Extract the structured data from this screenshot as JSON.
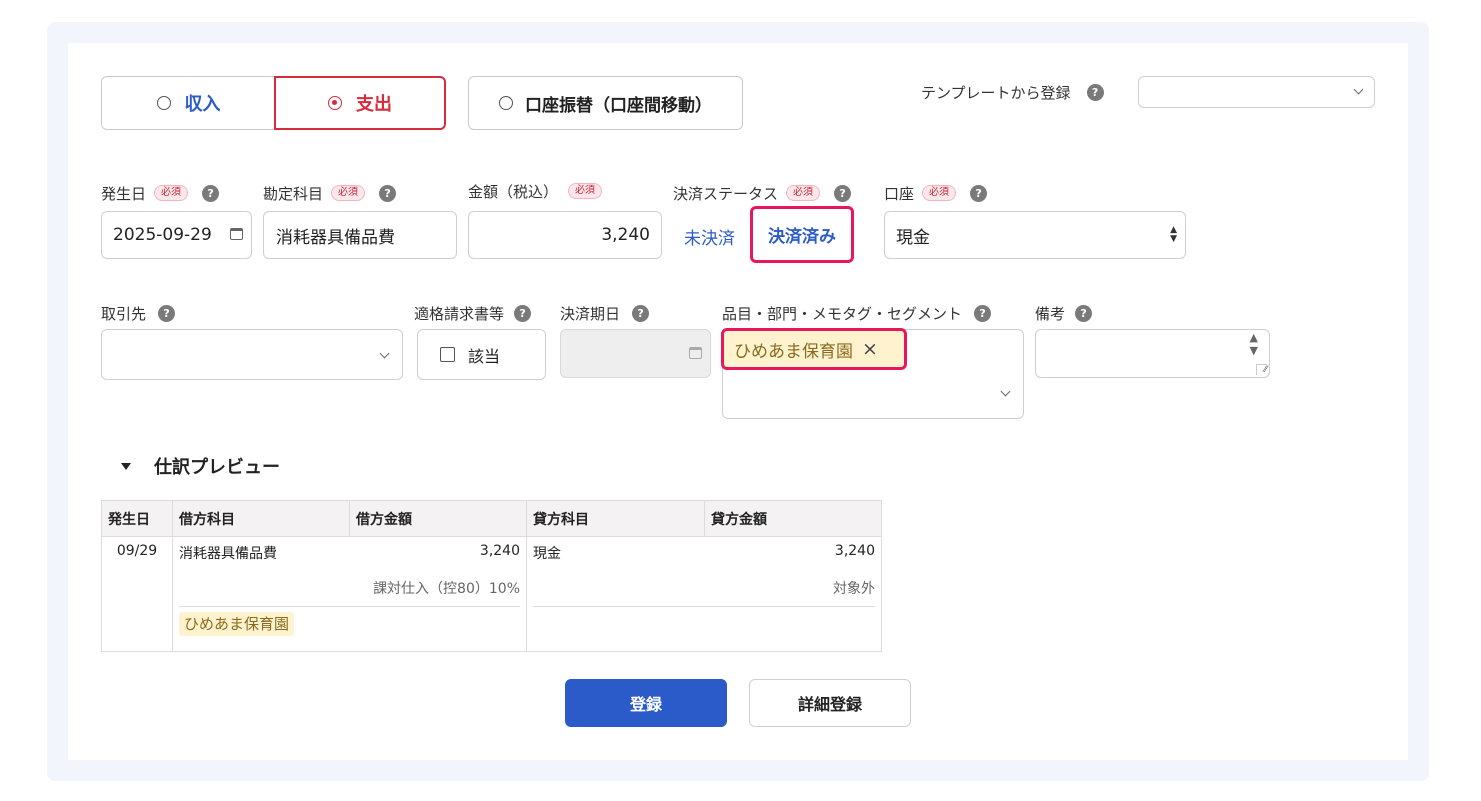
{
  "type_selector": {
    "income": "収入",
    "expense": "支出",
    "transfer": "口座振替（口座間移動）",
    "selected": "expense"
  },
  "template": {
    "label": "テンプレートから登録",
    "help": "?",
    "value": ""
  },
  "required_badge": "必須",
  "help_glyph": "?",
  "fields": {
    "date": {
      "label": "発生日",
      "value": "2025-09-29"
    },
    "account_item": {
      "label": "勘定科目",
      "value": "消耗器具備品費"
    },
    "amount": {
      "label": "金額（税込）",
      "value": "3,240"
    },
    "settlement_status": {
      "label": "決済ステータス",
      "unsettled": "未決済",
      "settled": "決済済み",
      "selected": "settled"
    },
    "wallet": {
      "label": "口座",
      "value": "現金"
    },
    "partner": {
      "label": "取引先",
      "value": ""
    },
    "invoice": {
      "label": "適格請求書等",
      "checkbox_label": "該当",
      "checked": false
    },
    "due_date": {
      "label": "決済期日",
      "value": ""
    },
    "tags": {
      "label": "品目・部門・メモタグ・セグメント",
      "items": [
        "ひめあま保育園"
      ],
      "remove_glyph": "×"
    },
    "remarks": {
      "label": "備考",
      "value": ""
    }
  },
  "preview": {
    "title": "仕訳プレビュー",
    "headers": [
      "発生日",
      "借方科目",
      "借方金額",
      "貸方科目",
      "貸方金額"
    ],
    "row": {
      "date": "09/29",
      "debit_account": "消耗器具備品費",
      "debit_amount": "3,240",
      "debit_tax": "課対仕入（控80）10%",
      "debit_tag": "ひめあま保育園",
      "credit_account": "現金",
      "credit_amount": "3,240",
      "credit_tax": "対象外"
    }
  },
  "buttons": {
    "register": "登録",
    "detail_register": "詳細登録"
  },
  "colors": {
    "accent_blue": "#2b5bc8",
    "danger_red": "#d62b3b",
    "highlight_pink": "#e8175d",
    "tag_bg": "#fff3cf"
  }
}
